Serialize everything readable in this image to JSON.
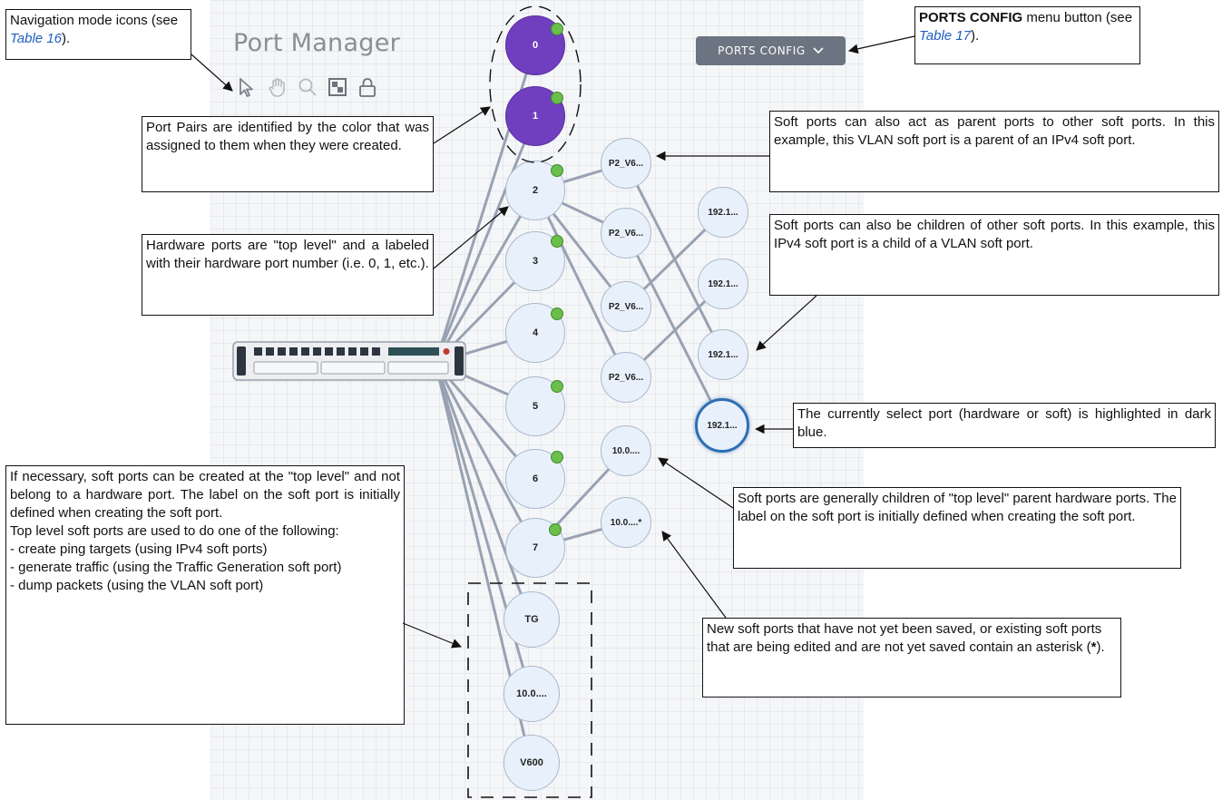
{
  "app": {
    "title": "Port Manager",
    "ports_config_label": "PORTS CONFIG",
    "toolbar_icons": [
      "pointer-icon",
      "hand-pan-icon",
      "zoom-icon",
      "fit-screen-icon",
      "lock-icon"
    ]
  },
  "colors": {
    "port_pair": "#6f3fbf",
    "port_default": "#e8f1fb",
    "status_dot": "#6abf4b",
    "selected_outline": "#2f6fb3",
    "button_bg": "#6b7480"
  },
  "hardware_ports": [
    {
      "label": "0",
      "pair": true
    },
    {
      "label": "1",
      "pair": true
    },
    {
      "label": "2"
    },
    {
      "label": "3"
    },
    {
      "label": "4"
    },
    {
      "label": "5"
    },
    {
      "label": "6"
    },
    {
      "label": "7"
    }
  ],
  "soft_ports": {
    "vlan": [
      "P2_V6...",
      "P2_V6...",
      "P2_V6...",
      "P2_V6..."
    ],
    "ipv4": [
      "192.1...",
      "192.1...",
      "192.1...",
      "192.1..."
    ],
    "port7_children": [
      "10.0....",
      "10.0....*"
    ],
    "top_level": [
      "TG",
      "10.0....",
      "V600"
    ]
  },
  "callouts": {
    "nav_icons": {
      "text1": "Navigation mode icons (see ",
      "link": "Table 16",
      "text2": ")."
    },
    "ports_config": {
      "bold": "PORTS CONFIG",
      "text1": " menu button (see ",
      "link": "Table 17",
      "text2": ")."
    },
    "port_pairs": "Port Pairs are identified by the color that was assigned to them when they were created.",
    "soft_parent": "Soft ports can also act as parent ports to other soft ports. In this example, this VLAN soft port is a parent of an IPv4 soft port.",
    "soft_child": "Soft ports can also be children of other soft ports. In this example, this IPv4 soft port is a child of a VLAN soft port.",
    "hardware_ports": "Hardware ports are \"top level\" and a labeled with their hardware port number (i.e. 0, 1, etc.).",
    "selected_port": "The currently select port (hardware or soft) is highlighted in dark blue.",
    "soft_generally": "Soft ports are generally children of \"top level\" parent hardware ports. The label on the soft port is initially defined when creating the soft port.",
    "top_level": {
      "para": "If necessary, soft ports can be created at the \"top level\" and not belong to a hardware port. The label on the soft port is initially defined when creating the soft port.",
      "intro": "Top level soft ports are used to do one of the following:",
      "items": [
        "- create ping targets (using IPv4 soft ports)",
        "- generate traffic (using the Traffic Generation soft port)",
        "- dump packets (using the VLAN soft port)"
      ]
    },
    "asterisk": {
      "text1": "New soft ports that have not yet been saved, or existing soft ports that are being edited and are not yet saved contain an asterisk (",
      "bold": "*",
      "text2": ")."
    }
  }
}
